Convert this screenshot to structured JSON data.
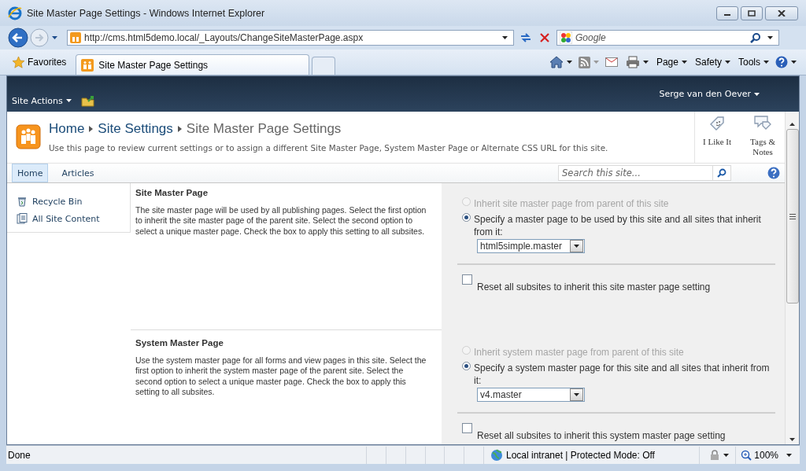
{
  "window": {
    "title": "Site Master Page Settings - Windows Internet Explorer"
  },
  "address_bar": {
    "url": "http://cms.html5demo.local/_Layouts/ChangeSiteMasterPage.aspx"
  },
  "search_box": {
    "placeholder": "Google"
  },
  "favorites": {
    "label": "Favorites"
  },
  "tabs": [
    {
      "label": "Site Master Page Settings",
      "selected": true
    }
  ],
  "command_bar": {
    "menus": [
      "Page",
      "Safety",
      "Tools"
    ]
  },
  "site": {
    "site_actions": "Site Actions",
    "user": "Serge van den Oever",
    "breadcrumb": [
      "Home",
      "Site Settings",
      "Site Master Page Settings"
    ],
    "description": "Use this page to review current settings or to assign a different Site Master Page, System Master Page or Alternate CSS URL for this site.",
    "social": [
      "I Like It",
      "Tags & Notes"
    ],
    "nav_tabs": [
      {
        "label": "Home",
        "selected": true
      },
      {
        "label": "Articles",
        "selected": false
      }
    ],
    "search": {
      "placeholder": "Search this site..."
    },
    "quick_launch": [
      {
        "label": "Recycle Bin",
        "kind": "recycle"
      },
      {
        "label": "All Site Content",
        "kind": "content"
      }
    ]
  },
  "sections": [
    {
      "title": "Site Master Page",
      "description": "The site master page will be used by all publishing pages. Select the first option to inherit the site master page of the parent site. Select the second option to select a unique master page. Check the box to apply this setting to all subsites.",
      "options": [
        {
          "label": "Inherit site master page from parent of this site",
          "selected": false,
          "disabled": true
        },
        {
          "label": "Specify a master page to be used by this site and all sites that inherit from it:",
          "selected": true,
          "disabled": false
        }
      ],
      "dropdown": "html5simple.master",
      "reset": {
        "label": "Reset all subsites to inherit this site master page setting",
        "checked": false
      }
    },
    {
      "title": "System Master Page",
      "description": "Use the system master page for all forms and view pages in this site. Select the first option to inherit the system master page of the parent site. Select the second option to select a unique master page. Check the box to apply this setting to all subsites.",
      "options": [
        {
          "label": "Inherit system master page from parent of this site",
          "selected": false,
          "disabled": true
        },
        {
          "label": "Specify a system master page for this site and all sites that inherit from it:",
          "selected": true,
          "disabled": false
        }
      ],
      "dropdown": "v4.master",
      "reset": {
        "label": "Reset all subsites to inherit this system master page setting",
        "checked": false
      }
    }
  ],
  "status_bar": {
    "text": "Done",
    "zone": "Local intranet | Protected Mode: Off",
    "zoom": "100%"
  }
}
